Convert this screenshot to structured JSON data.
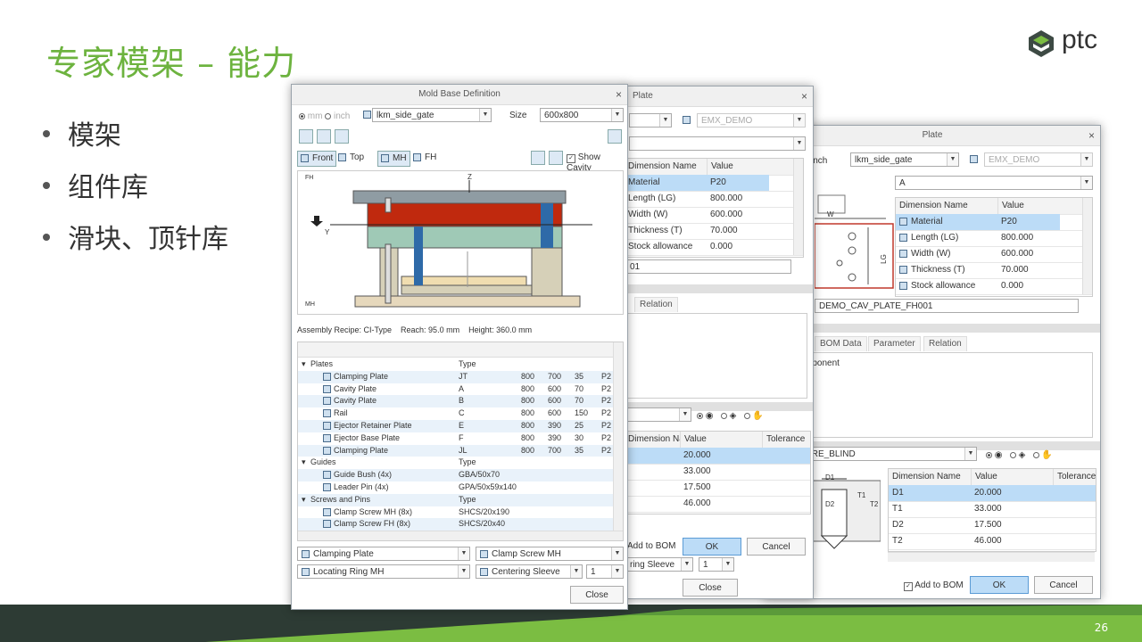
{
  "slide": {
    "title": "专家模架 – 能力",
    "bullets": [
      "模架",
      "组件库",
      "滑块、顶针库"
    ],
    "page_number": "26",
    "logo_text": "ptc",
    "colors": {
      "title": "#6db33f",
      "footer_dark": "#2d3b34",
      "footer_green": "#7bbd42"
    }
  },
  "mold_base": {
    "title": "Mold Base Definition",
    "unit_mm": "mm",
    "unit_inch": "inch",
    "catalog": "lkm_side_gate",
    "size_label": "Size",
    "size_value": "600x800",
    "view_front": "Front",
    "view_top": "Top",
    "view_mh": "MH",
    "view_fh": "FH",
    "show_cavity": "Show Cavity",
    "axis_fh": "FH",
    "axis_mh": "MH",
    "axis_z": "Z",
    "axis_y": "Y",
    "recipe_text": "Assembly Recipe: CI-Type    Reach: 95.0 mm    Height: 360.0 mm",
    "groups": [
      {
        "name": "Plates",
        "type_header": "Type",
        "items": [
          {
            "name": "Clamping Plate",
            "type": "JT",
            "c1": "800",
            "c2": "700",
            "c3": "35",
            "c4": "P2"
          },
          {
            "name": "Cavity Plate",
            "type": "A",
            "c1": "800",
            "c2": "600",
            "c3": "70",
            "c4": "P2"
          },
          {
            "name": "Cavity Plate",
            "type": "B",
            "c1": "800",
            "c2": "600",
            "c3": "70",
            "c4": "P2"
          },
          {
            "name": "Rail",
            "type": "C",
            "c1": "800",
            "c2": "600",
            "c3": "150",
            "c4": "P2"
          },
          {
            "name": "Ejector Retainer Plate",
            "type": "E",
            "c1": "800",
            "c2": "390",
            "c3": "25",
            "c4": "P2"
          },
          {
            "name": "Ejector Base Plate",
            "type": "F",
            "c1": "800",
            "c2": "390",
            "c3": "30",
            "c4": "P2"
          },
          {
            "name": "Clamping Plate",
            "type": "JL",
            "c1": "800",
            "c2": "700",
            "c3": "35",
            "c4": "P2"
          }
        ]
      },
      {
        "name": "Guides",
        "type_header": "Type",
        "items": [
          {
            "name": "Guide Bush (4x)",
            "type": "GBA/50x70"
          },
          {
            "name": "Leader Pin (4x)",
            "type": "GPA/50x59x140"
          }
        ]
      },
      {
        "name": "Screws and Pins",
        "type_header": "Type",
        "items": [
          {
            "name": "Clamp Screw MH (8x)",
            "type": "SHCS/20x190"
          },
          {
            "name": "Clamp Screw FH (8x)",
            "type": "SHCS/20x40"
          }
        ]
      }
    ],
    "combo_clamping_plate": "Clamping Plate",
    "combo_clamp_screw": "Clamp Screw MH",
    "combo_locating_ring": "Locating Ring MH",
    "combo_centering_sleeve": "Centering Sleeve",
    "combo_qty": "1",
    "close": "Close"
  },
  "plate_mid": {
    "title": "Plate",
    "catalog": "EMX_DEMO",
    "dim_header": "Dimension Name",
    "val_header": "Value",
    "dims": [
      {
        "name": "Material",
        "value": "P20"
      },
      {
        "name": "Length (LG)",
        "value": "800.000"
      },
      {
        "name": "Width (W)",
        "value": "600.000"
      },
      {
        "name": "Thickness (T)",
        "value": "70.000"
      },
      {
        "name": "Stock allowance",
        "value": "0.000"
      }
    ],
    "name_field": "01",
    "tab_relation": "Relation",
    "dims2_name_header": "Dimension Name",
    "dims2_value_header": "Value",
    "dims2_tol_header": "Tolerance",
    "dims2": [
      "20.000",
      "33.000",
      "17.500",
      "46.000"
    ],
    "add_to_bom": "Add to BOM",
    "ok": "OK",
    "cancel": "Cancel",
    "combo_sleeve": "ring Sleeve",
    "combo_qty": "1",
    "close": "Close"
  },
  "plate_front": {
    "title": "Plate",
    "unit_inch": "inch",
    "catalog": "lkm_side_gate",
    "library": "EMX_DEMO",
    "type": "A",
    "dim_header": "Dimension Name",
    "val_header": "Value",
    "dims": [
      {
        "name": "Material",
        "value": "P20"
      },
      {
        "name": "Length (LG)",
        "value": "800.000"
      },
      {
        "name": "Width (W)",
        "value": "600.000"
      },
      {
        "name": "Thickness (T)",
        "value": "70.000"
      },
      {
        "name": "Stock allowance",
        "value": "0.000"
      }
    ],
    "sketch_w": "W",
    "sketch_lg": "LG",
    "name_field": "DEMO_CAV_PLATE_FH001",
    "tab_bom": "BOM Data",
    "tab_param": "Parameter",
    "tab_relation": "Relation",
    "panel_text": "mponent",
    "blind": "ORE_BLIND",
    "sketch_d1": "D1",
    "sketch_d2": "D2",
    "sketch_t1": "T1",
    "sketch_t2": "T2",
    "dims2_name_header": "Dimension Name",
    "dims2_value_header": "Value",
    "dims2_tol_header": "Tolerance",
    "dims2": [
      {
        "name": "D1",
        "value": "20.000"
      },
      {
        "name": "T1",
        "value": "33.000"
      },
      {
        "name": "D2",
        "value": "17.500"
      },
      {
        "name": "T2",
        "value": "46.000"
      }
    ],
    "add_to_bom": "Add to BOM",
    "ok": "OK",
    "cancel": "Cancel"
  }
}
